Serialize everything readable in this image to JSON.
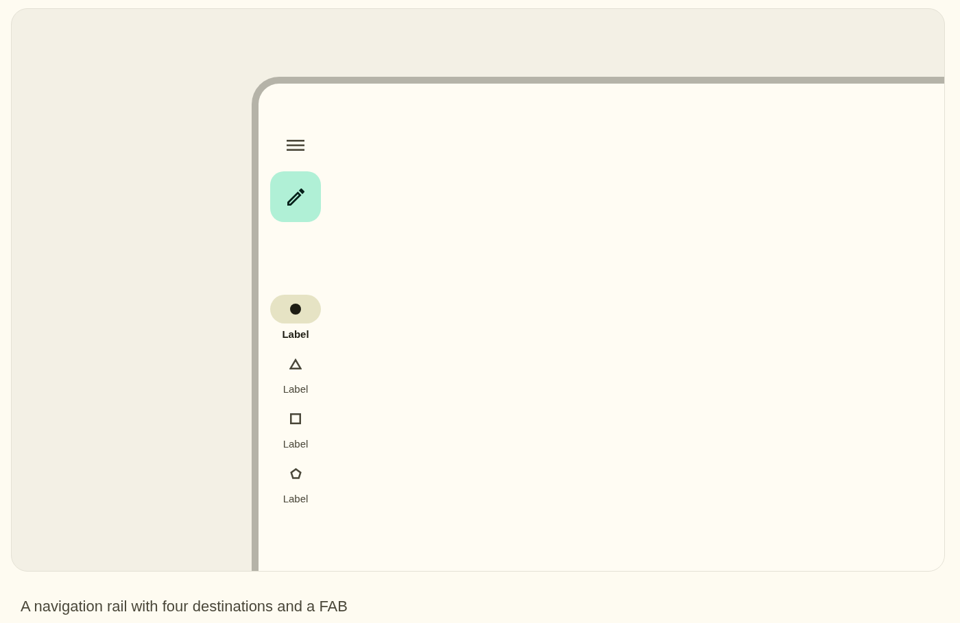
{
  "rail": {
    "destinations": [
      {
        "label": "Label",
        "selected": true
      },
      {
        "label": "Label",
        "selected": false
      },
      {
        "label": "Label",
        "selected": false
      },
      {
        "label": "Label",
        "selected": false
      }
    ]
  },
  "caption": "A navigation rail with four destinations and a FAB"
}
